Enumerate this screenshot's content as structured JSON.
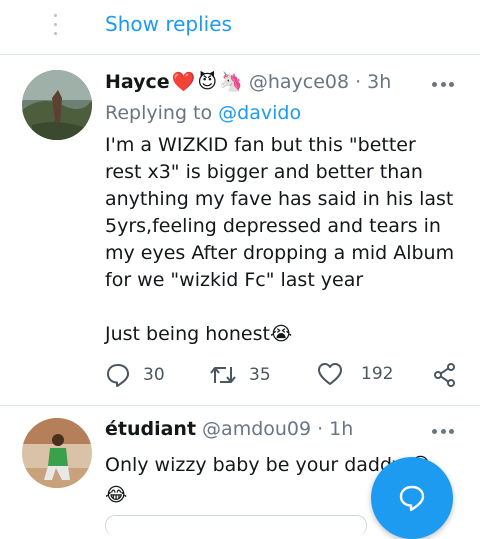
{
  "thread": {
    "show_replies_label": "Show replies"
  },
  "tweet1": {
    "name": "Hayce",
    "name_emojis": [
      "❤️",
      "😈",
      "🦄"
    ],
    "handle": "@hayce08",
    "separator": "·",
    "time": "3h",
    "replying_prefix": "Replying to",
    "replying_to": "@davido",
    "text_line1": "I'm a WIZKID fan but this \"better rest x3\" is bigger and better than anything my fave has said in his last 5yrs,feeling depressed and tears in my eyes After dropping a mid Album for we \"wizkid Fc\" last year",
    "text_line2": "Just being honest😭",
    "reply_count": "30",
    "retweet_count": "35",
    "like_count": "192"
  },
  "tweet2": {
    "name": "étudiant",
    "handle": "@amdou09",
    "separator": "·",
    "time": "1h",
    "text": "Only wizzy baby be your daddy 😂 😂"
  },
  "colors": {
    "accent": "#1d9bf0",
    "muted": "#687684",
    "separator": "#e1e8ed"
  },
  "icons": [
    "more-vertical-icon",
    "more-horizontal-icon",
    "reply-icon",
    "retweet-icon",
    "like-icon",
    "share-icon",
    "compose-reply-icon"
  ]
}
